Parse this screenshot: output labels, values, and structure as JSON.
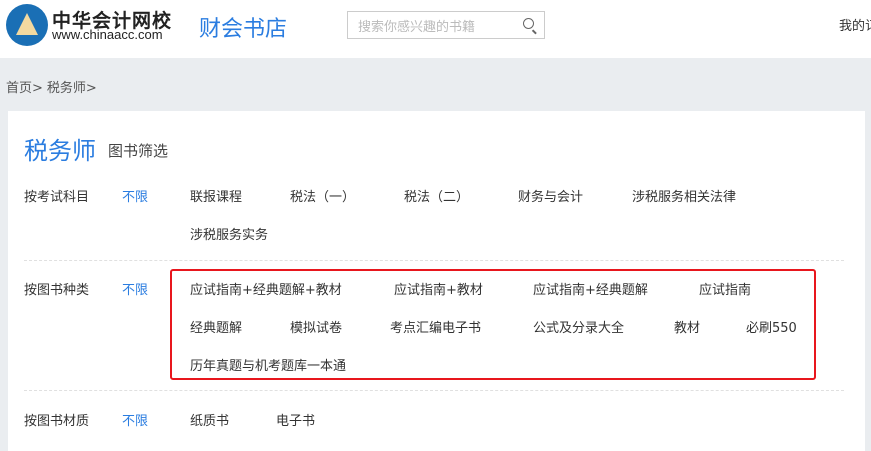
{
  "header": {
    "brand_cn": "中华会计网校",
    "brand_url": "www.chinaacc.com",
    "store": "财会书店",
    "search_placeholder": "搜索你感兴趣的书籍",
    "my_link": "我的订"
  },
  "breadcrumb": [
    "首页>",
    "税务师>"
  ],
  "page": {
    "title": "税务师",
    "subtitle": "图书筛选"
  },
  "filters": [
    {
      "label": "按考试科目",
      "all": "不限",
      "items": [
        "联报课程",
        "税法（一）",
        "税法（二）",
        "财务与会计",
        "涉税服务相关法律",
        "涉税服务实务"
      ]
    },
    {
      "label": "按图书种类",
      "all": "不限",
      "items": [
        "应试指南+经典题解+教材",
        "应试指南+教材",
        "应试指南+经典题解",
        "应试指南",
        "经典题解",
        "模拟试卷",
        "考点汇编电子书",
        "公式及分录大全",
        "教材",
        "必刷550",
        "历年真题与机考题库一本通"
      ]
    },
    {
      "label": "按图书材质",
      "all": "不限",
      "items": [
        "纸质书",
        "电子书"
      ]
    }
  ],
  "colors": {
    "accent": "#2b7de0",
    "highlight": "#e8161d"
  }
}
